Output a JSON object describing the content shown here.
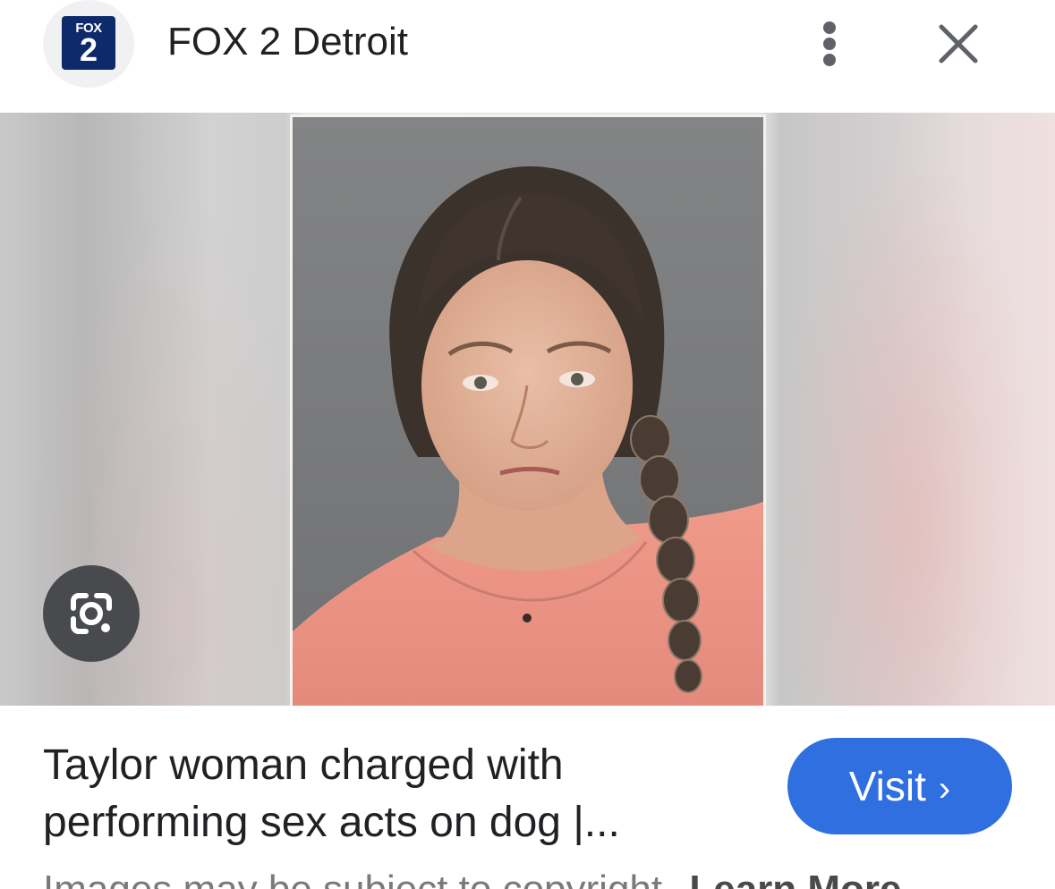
{
  "header": {
    "logo": {
      "top_text": "FOX",
      "number": "2"
    },
    "source_name": "FOX 2 Detroit",
    "more_icon": "more-vert-icon",
    "close_icon": "close-icon"
  },
  "image": {
    "lens_icon": "lens-search-icon"
  },
  "caption": {
    "title": "Taylor woman charged with performing sex acts on dog |..."
  },
  "visit_button": {
    "label": "Visit",
    "chevron": "›",
    "color": "#2f6fe0"
  },
  "footer": {
    "copyright_text": "Images may be subject to copyright.",
    "learn_more": "Learn More"
  },
  "colors": {
    "logo_background": "#0d2a6b",
    "text_primary": "#202124",
    "icon_gray": "#5f6368",
    "lens_button": "#484a4d"
  }
}
